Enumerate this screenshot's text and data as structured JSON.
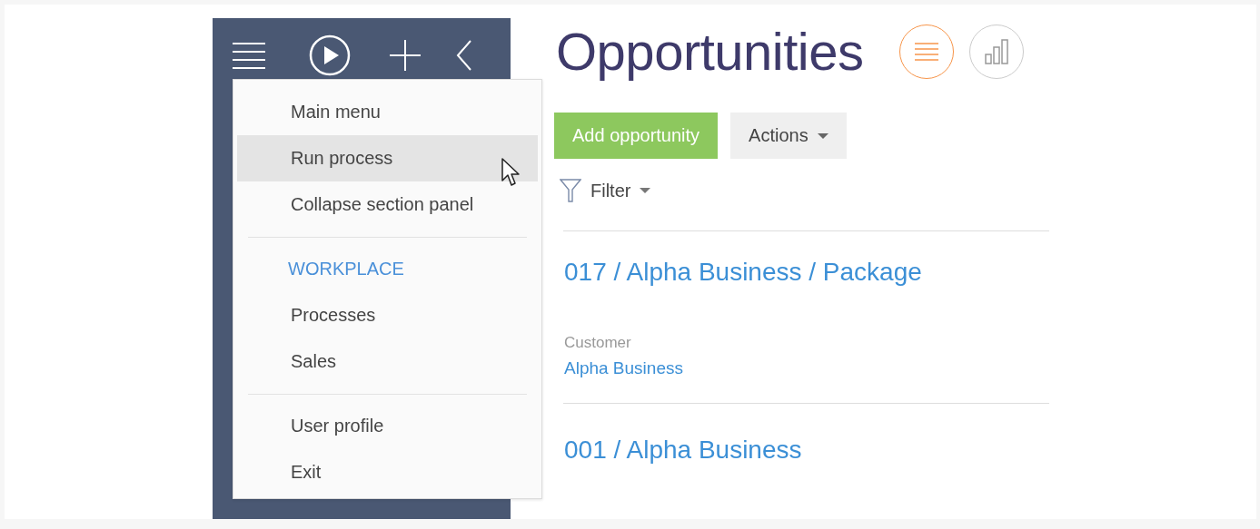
{
  "menu": {
    "items": [
      {
        "kind": "item",
        "label": "Main menu",
        "selected": false
      },
      {
        "kind": "item",
        "label": "Run process",
        "selected": true
      },
      {
        "kind": "item",
        "label": "Collapse section panel",
        "selected": false
      },
      {
        "kind": "divider"
      },
      {
        "kind": "header",
        "label": "WORKPLACE"
      },
      {
        "kind": "item",
        "label": "Processes",
        "selected": false
      },
      {
        "kind": "item",
        "label": "Sales",
        "selected": false
      },
      {
        "kind": "divider"
      },
      {
        "kind": "item",
        "label": "User profile",
        "selected": false
      },
      {
        "kind": "item",
        "label": "Exit",
        "selected": false
      }
    ]
  },
  "page": {
    "title": "Opportunities",
    "view_buttons": [
      {
        "kind": "list",
        "selected": true
      },
      {
        "kind": "analytics",
        "selected": false
      }
    ],
    "buttons": [
      {
        "kind": "primary",
        "label": "Add opportunity"
      },
      {
        "kind": "dropdown",
        "label": "Actions"
      }
    ],
    "filter": {
      "label": "Filter"
    },
    "records": [
      {
        "title": "017 / Alpha Business / Package",
        "fields": [
          {
            "label": "Customer",
            "value": "Alpha Business"
          }
        ]
      },
      {
        "title": "001 / Alpha Business"
      }
    ]
  }
}
